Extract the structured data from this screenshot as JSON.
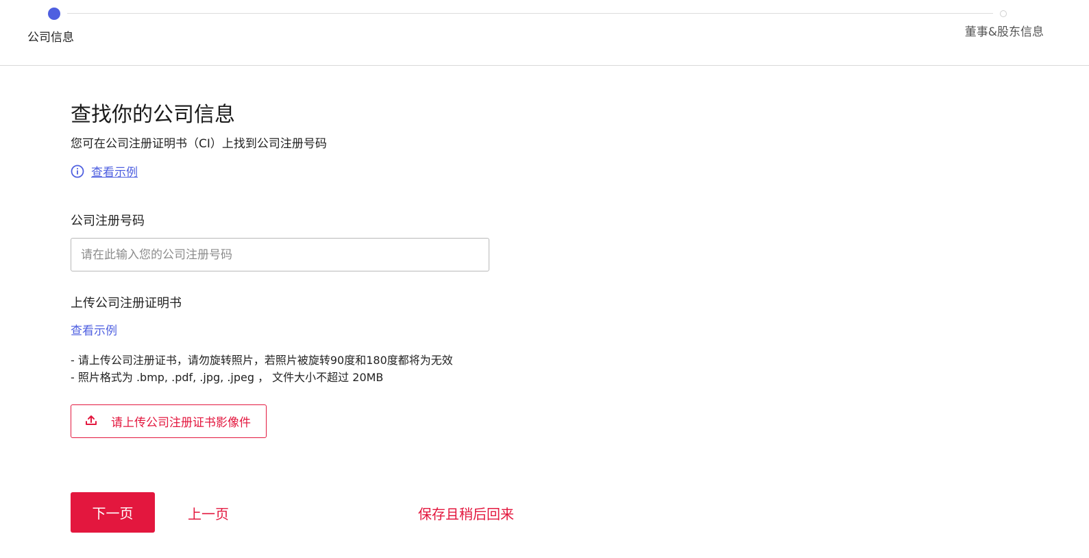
{
  "stepper": {
    "steps": [
      {
        "label": "公司信息",
        "state": "active"
      },
      {
        "label": "董事&股东信息",
        "state": "inactive"
      }
    ],
    "active_color": "#4e5fe0"
  },
  "main": {
    "title": "查找你的公司信息",
    "subtitle": "您可在公司注册证明书（CI）上找到公司注册号码",
    "example_link_label": "查看示例",
    "info_icon": "info-circle-icon"
  },
  "registration_field": {
    "label": "公司注册号码",
    "value": "",
    "placeholder": "请在此输入您的公司注册号码"
  },
  "upload": {
    "label": "上传公司注册证明书",
    "example_link_label": "查看示例",
    "notes": [
      "- 请上传公司注册证书，请勿旋转照片，若照片被旋转90度和180度都将为无效",
      "- 照片格式为 .bmp, .pdf, .jpg, .jpeg ， 文件大小不超过 20MB"
    ],
    "button_label": "请上传公司注册证书影像件",
    "button_icon": "upload-icon"
  },
  "actions": {
    "next_label": "下一页",
    "prev_label": "上一页",
    "save_later_label": "保存且稍后回来"
  },
  "colors": {
    "brand_red": "#e3173e",
    "link_blue": "#4e5fe0"
  }
}
